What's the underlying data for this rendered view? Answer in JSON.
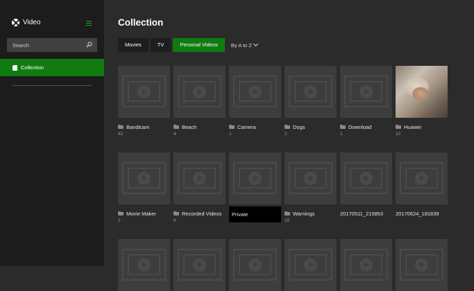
{
  "app": {
    "title": "Video",
    "logo_icon": "xbox-logo-icon",
    "menu_icon": "hamburger-icon"
  },
  "search": {
    "placeholder": "Search",
    "value": ""
  },
  "sidebar": {
    "nav_label": "Collection"
  },
  "main": {
    "title": "Collection",
    "filters": [
      "Movies",
      "TV",
      "Personal Videos"
    ],
    "active_filter": "Personal Videos",
    "sort_label": "By A to Z"
  },
  "tiles": [
    {
      "name": "Bandicam",
      "count": "62"
    },
    {
      "name": "Beach",
      "count": "4"
    },
    {
      "name": "Camera",
      "count": "1"
    },
    {
      "name": "Dogs",
      "count": "2"
    },
    {
      "name": "Download",
      "count": "1"
    },
    {
      "name": "Huawei",
      "count": "10"
    },
    {
      "name": "Movie Maker",
      "count": "2"
    },
    {
      "name": "Recorded Videos",
      "count": "6"
    },
    {
      "name": "Private",
      "count": ""
    },
    {
      "name": "Warnings",
      "count": "16"
    },
    {
      "name": "20170511_215853",
      "count": ""
    },
    {
      "name": "20170624_181839",
      "count": ""
    }
  ],
  "colors": {
    "accent": "#107c10",
    "sidebar_bg": "#1c1c1c",
    "main_bg": "#2b2b2b",
    "tile_bg": "#3d3d3d"
  }
}
